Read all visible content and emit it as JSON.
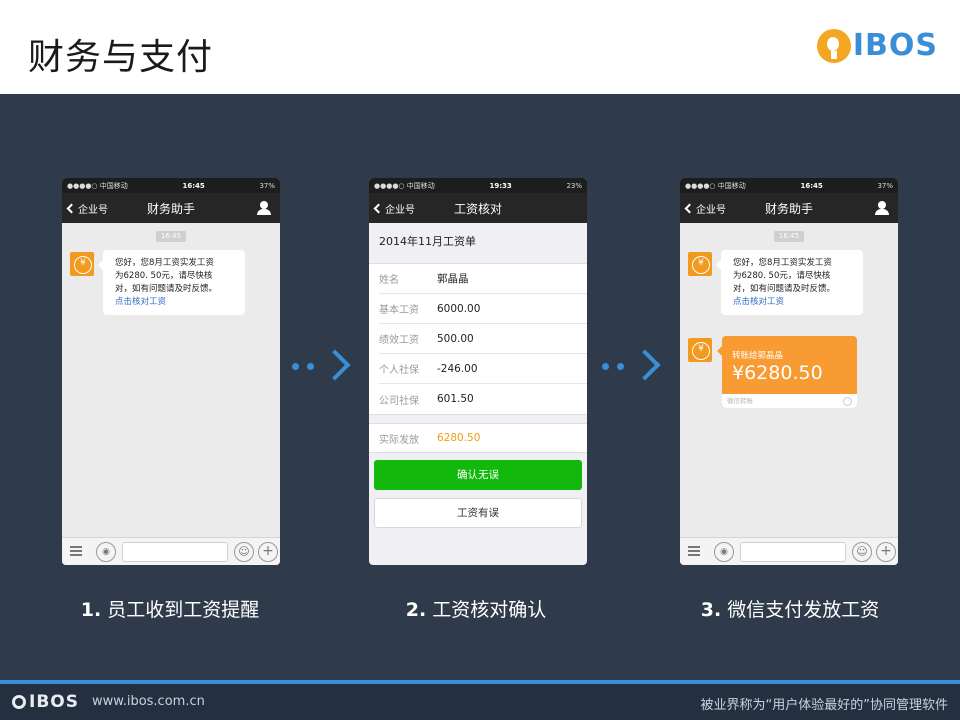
{
  "header": {
    "title": "财务与支付",
    "logo_text": "IBOS"
  },
  "colors": {
    "accent": "#3a8ed8",
    "confirm": "#12b80c",
    "transfer": "#f89b33",
    "background": "#2f3b4a"
  },
  "phone1": {
    "status": {
      "carrier": "●●●●○ 中国移动",
      "time": "16:45",
      "battery": "37%"
    },
    "nav": {
      "back_label": "企业号",
      "title": "财务助手"
    },
    "chat_time": "16:45",
    "message": {
      "lines": [
        "您好，您8月工资实发工资",
        "为6280. 50元，请尽快核",
        "对，如有问题请及时反馈。"
      ],
      "link": "点击核对工资"
    }
  },
  "phone2": {
    "status": {
      "carrier": "●●●●○ 中国移动",
      "time": "19:33",
      "battery": "23%"
    },
    "nav": {
      "back_label": "企业号",
      "title": "工资核对"
    },
    "sheet_title": "2014年11月工资单",
    "rows": [
      {
        "key": "姓名",
        "value": "郭晶晶"
      },
      {
        "key": "基本工资",
        "value": "6000.00"
      },
      {
        "key": "绩效工资",
        "value": "500.00"
      },
      {
        "key": "个人社保",
        "value": "-246.00"
      },
      {
        "key": "公司社保",
        "value": "601.50"
      }
    ],
    "actual": {
      "key": "实际发放",
      "value": "6280.50"
    },
    "confirm_label": "确认无误",
    "error_label": "工资有误"
  },
  "phone3": {
    "status": {
      "carrier": "●●●●○ 中国移动",
      "time": "16:45",
      "battery": "37%"
    },
    "nav": {
      "back_label": "企业号",
      "title": "财务助手"
    },
    "chat_time": "16:45",
    "message": {
      "lines": [
        "您好，您8月工资实发工资",
        "为6280. 50元，请尽快核",
        "对，如有问题请及时反馈。"
      ],
      "link": "点击核对工资"
    },
    "transfer": {
      "to": "转账给郭晶晶",
      "amount": "¥6280.50",
      "footer": "微信转账"
    }
  },
  "steps": [
    {
      "num": "1.",
      "label": "员工收到工资提醒"
    },
    {
      "num": "2.",
      "label": "工资核对确认"
    },
    {
      "num": "3.",
      "label": "微信支付发放工资"
    }
  ],
  "footer": {
    "logo": "IBOS",
    "url": "www.ibos.com.cn",
    "slogan": "被业界称为“用户体验最好的”协同管理软件"
  }
}
